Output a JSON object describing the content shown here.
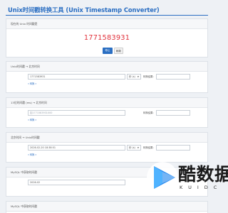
{
  "page": {
    "title": "Unix时间戳转换工具 (Unix Timestamp Converter)"
  },
  "clock": {
    "header": "现在的 Unix 时间戳是",
    "value": "1771583931",
    "stop_label": "停止",
    "refresh_label": "刷新"
  },
  "unix_to_date": {
    "header": "Unix时间戳 → 北京时间",
    "input_value": "1771583931",
    "unit": "秒 (s)",
    "result_label": "转换结果:",
    "convert_label": "» 转换 »"
  },
  "ms_to_date": {
    "header": "13位时间戳 (ms) → 北京时间",
    "input_placeholder": "如1771583931000",
    "result_label": "转换结果:",
    "convert_label": "» 转换 »"
  },
  "date_to_unix": {
    "header": "北京时间 → Unix时间戳",
    "input_value": "2026-02-20 18:38:51",
    "unit": "秒 (s)",
    "result_label": "转换结果:",
    "convert_label": "» 转换 »"
  },
  "mysql_1": {
    "header": "MySQL 中获取时间戳",
    "input_value": "2026-02"
  },
  "mysql_2": {
    "header": "MySQL 中获取时间戳"
  },
  "watermark": {
    "brand": "酷数据",
    "sub": "KUIDC"
  },
  "colors": {
    "accent": "#2a6ec2",
    "clock_red": "#e0313b",
    "background": "#eef1f5"
  },
  "icons": {
    "watermark_logo": "play-triangle-icon"
  }
}
